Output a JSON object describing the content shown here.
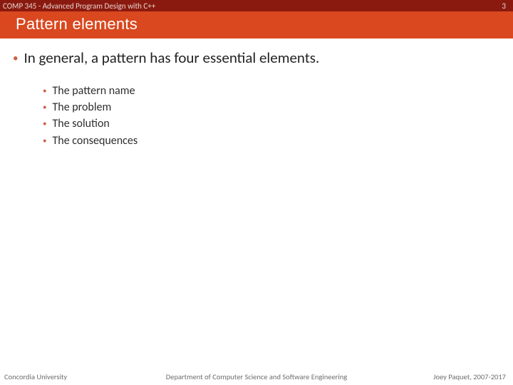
{
  "header": {
    "course": "COMP 345 - Advanced Program Design with C++",
    "slide_number": "3"
  },
  "title": "Pattern elements",
  "main_point": "In general, a pattern has four essential elements.",
  "sub_points": [
    "The pattern name",
    "The problem",
    "The solution",
    "The consequences"
  ],
  "footer": {
    "left": "Concordia University",
    "center": "Department of Computer Science and Software Engineering",
    "right": "Joey Paquet, 2007-2017"
  }
}
